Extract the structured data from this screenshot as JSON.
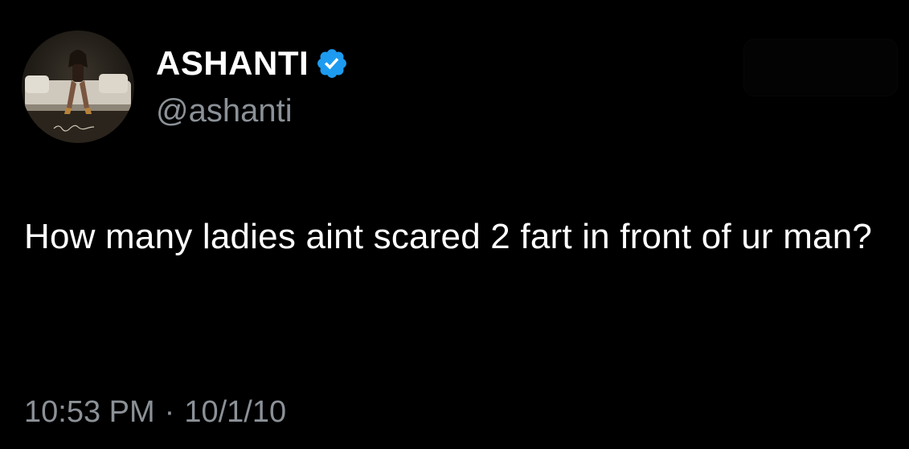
{
  "tweet": {
    "author": {
      "display_name": "ASHANTI",
      "handle": "@ashanti",
      "verified": true,
      "verified_color": "#1d9bf0",
      "avatar_icon": "profile-photo-album-cover"
    },
    "text": "How many ladies aint scared 2 fart in front of ur man?",
    "time": "10:53 PM",
    "separator": "·",
    "date": "10/1/10"
  },
  "colors": {
    "background": "#000000",
    "primary_text": "#ffffff",
    "secondary_text": "#8b9197",
    "verified_badge": "#1d9bf0"
  }
}
